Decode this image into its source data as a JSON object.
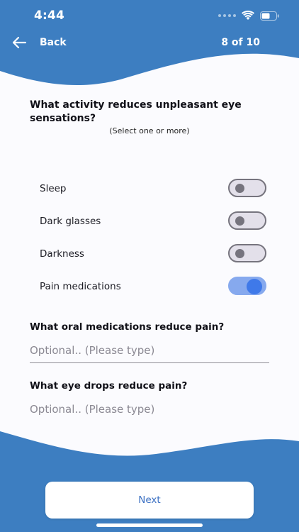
{
  "status_bar": {
    "time": "4:44"
  },
  "header": {
    "back_label": "Back",
    "progress": "8 of 10"
  },
  "question": {
    "title": "What activity reduces unpleasant eye sensations?",
    "hint": "(Select one or more)"
  },
  "options": [
    {
      "label": "Sleep",
      "checked": false
    },
    {
      "label": "Dark glasses",
      "checked": false
    },
    {
      "label": "Darkness",
      "checked": false
    },
    {
      "label": "Pain medications",
      "checked": true
    }
  ],
  "oral_medications": {
    "title": "What oral medications reduce pain?",
    "placeholder": "Optional.. (Please type)",
    "value": ""
  },
  "eye_drops": {
    "title": "What eye drops reduce pain?",
    "placeholder": "Optional.. (Please type)",
    "value": ""
  },
  "footer": {
    "next_label": "Next"
  },
  "colors": {
    "primary": "#3d7ec1",
    "background": "#fbfbfe",
    "toggle_on_track": "#86a9ee",
    "toggle_on_knob": "#3f79e9",
    "toggle_off": "#76747e"
  }
}
